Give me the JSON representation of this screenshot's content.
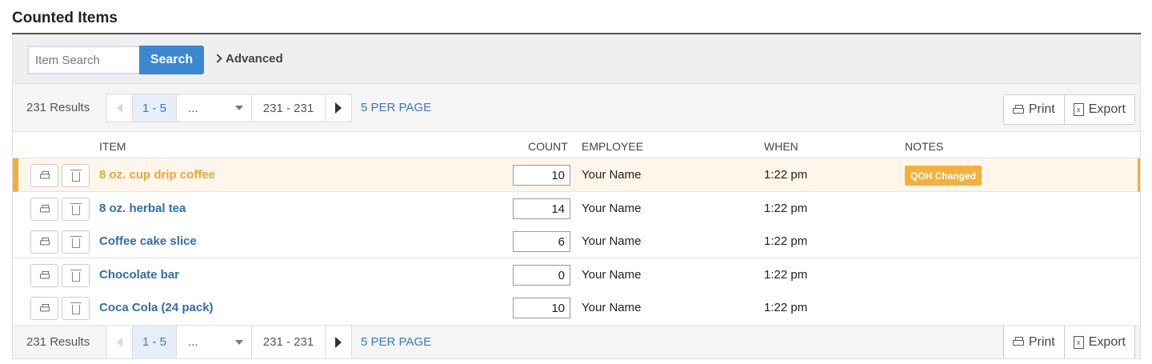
{
  "title": "Counted Items",
  "search": {
    "placeholder": "Item Search",
    "button_label": "Search",
    "advanced_label": "Advanced"
  },
  "pagination": {
    "results": "231 Results",
    "current_range": "1 - 5",
    "select_value": "...",
    "last_range": "231 - 231",
    "per_page": "5 PER PAGE"
  },
  "toolbar": {
    "print_label": "Print",
    "export_label": "Export"
  },
  "columns": {
    "item": "ITEM",
    "count": "COUNT",
    "employee": "EMPLOYEE",
    "when": "WHEN",
    "notes": "NOTES"
  },
  "rows": [
    {
      "item": "8 oz. cup drip coffee",
      "count": "10",
      "employee": "Your Name",
      "when": "1:22 pm",
      "note": "QOH Changed"
    },
    {
      "item": "8 oz. herbal tea",
      "count": "14",
      "employee": "Your Name",
      "when": "1:22 pm"
    },
    {
      "item": "Coffee cake slice",
      "count": "6",
      "employee": "Your Name",
      "when": "1:22 pm"
    },
    {
      "item": "Chocolate bar",
      "count": "0",
      "employee": "Your Name",
      "when": "1:22 pm"
    },
    {
      "item": "Coca Cola (24 pack)",
      "count": "10",
      "employee": "Your Name",
      "when": "1:22 pm"
    }
  ],
  "colors": {
    "accent": "#3b87d0",
    "link": "#2d6db4",
    "highlight": "#f3ad3b",
    "highlight_bg": "#fef6ea"
  }
}
